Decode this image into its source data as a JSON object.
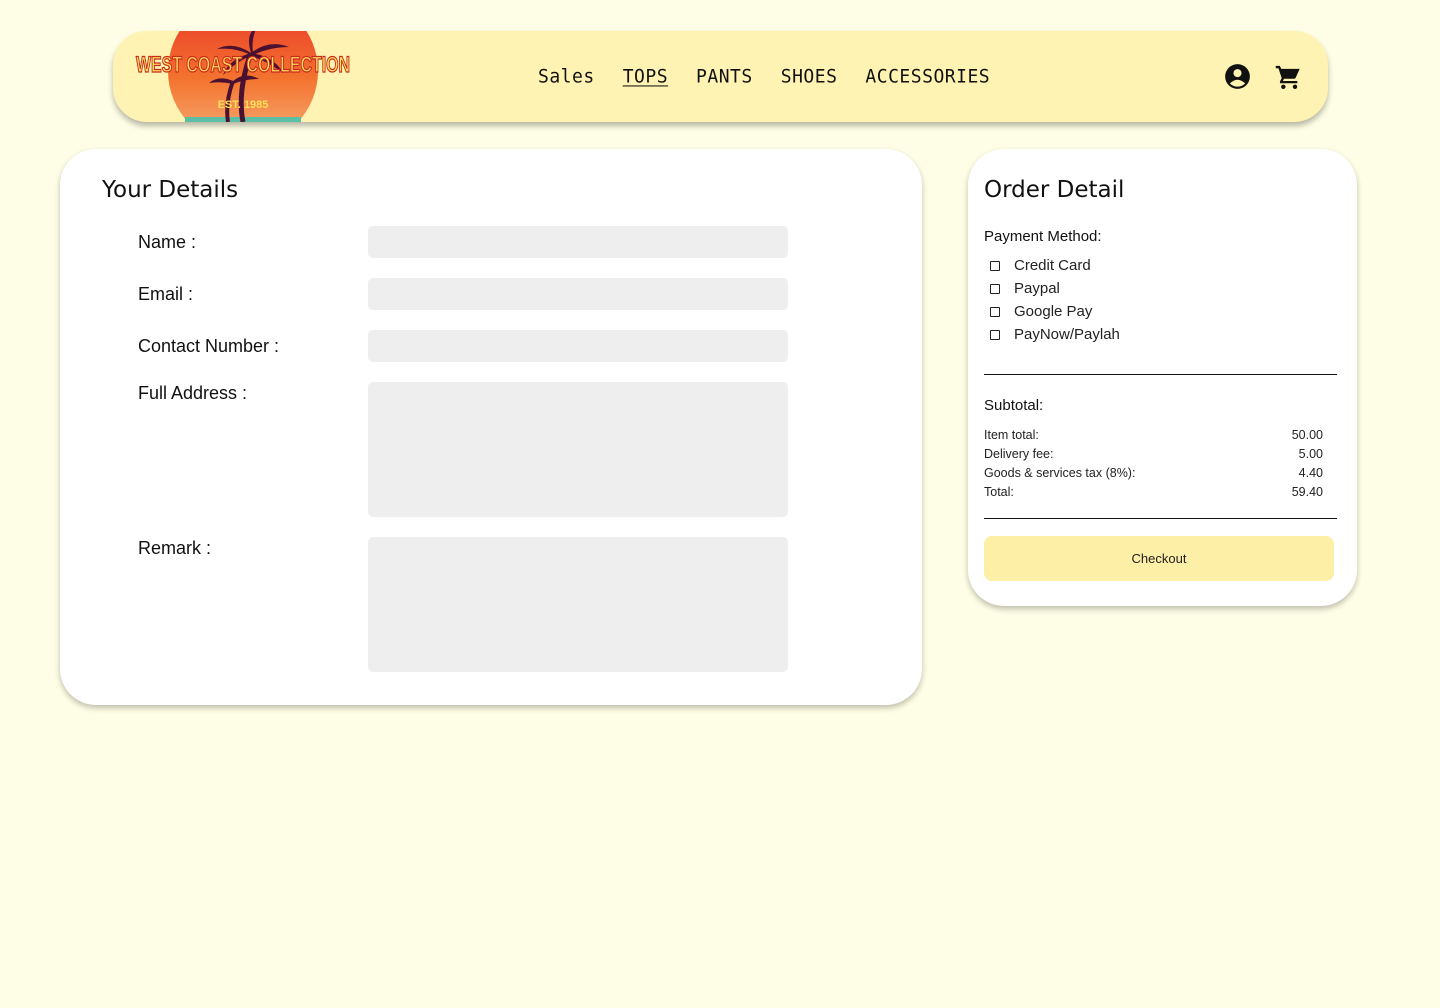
{
  "header": {
    "logo": {
      "brand": "WEST COAST COLLECTION",
      "est": "EST. 1985"
    },
    "nav": [
      {
        "label": "Sales",
        "active": false
      },
      {
        "label": "TOPS",
        "active": true
      },
      {
        "label": "PANTS",
        "active": false
      },
      {
        "label": "SHOES",
        "active": false
      },
      {
        "label": "ACCESSORIES",
        "active": false
      }
    ],
    "icons": [
      "account-icon",
      "cart-icon"
    ]
  },
  "details": {
    "title": "Your Details",
    "fields": {
      "name": {
        "label": "Name :",
        "value": ""
      },
      "email": {
        "label": "Email :",
        "value": ""
      },
      "contact": {
        "label": "Contact Number :",
        "value": ""
      },
      "address": {
        "label": "Full Address :",
        "value": ""
      },
      "remark": {
        "label": "Remark :",
        "value": ""
      }
    }
  },
  "order": {
    "title": "Order Detail",
    "payment_label": "Payment Method:",
    "payment_options": [
      "Credit Card",
      "Paypal",
      "Google Pay",
      "PayNow/Paylah"
    ],
    "subtotal_label": "Subtotal:",
    "summary": [
      {
        "label": "Item total:",
        "value": "50.00"
      },
      {
        "label": "Delivery fee:",
        "value": "5.00"
      },
      {
        "label": "Goods & services tax (8%):",
        "value": "4.40"
      },
      {
        "label": "Total:",
        "value": "59.40"
      }
    ],
    "checkout_label": "Checkout"
  },
  "colors": {
    "page_bg": "#fefee6",
    "header_bg": "#fef3b2",
    "input_bg": "#eeeeee",
    "button_bg": "#fdefa6"
  }
}
